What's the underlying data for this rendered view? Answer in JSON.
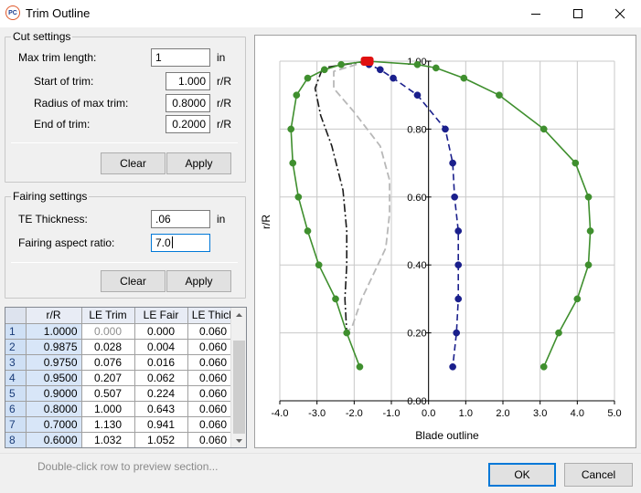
{
  "window": {
    "title": "Trim Outline",
    "app_icon_text": "PC"
  },
  "cut": {
    "legend": "Cut settings",
    "max_trim_label": "Max trim length:",
    "max_trim_value": "1",
    "max_trim_unit": "in",
    "start_label": "Start of trim:",
    "start_value": "1.000",
    "start_unit": "r/R",
    "radius_label": "Radius of max trim:",
    "radius_value": "0.8000",
    "radius_unit": "r/R",
    "end_label": "End of trim:",
    "end_value": "0.2000",
    "end_unit": "r/R",
    "clear_label": "Clear",
    "apply_label": "Apply"
  },
  "fairing": {
    "legend": "Fairing settings",
    "te_label": "TE Thickness:",
    "te_value": ".06",
    "te_unit": "in",
    "aspect_label": "Fairing aspect ratio:",
    "aspect_value": "7.0",
    "clear_label": "Clear",
    "apply_label": "Apply"
  },
  "table": {
    "columns": [
      "r/R",
      "LE Trim",
      "LE Fair",
      "LE Thick"
    ],
    "rows": [
      {
        "n": "1",
        "r": "1.0000",
        "trim": "0.000",
        "fair": "0.000",
        "thick": "0.060"
      },
      {
        "n": "2",
        "r": "0.9875",
        "trim": "0.028",
        "fair": "0.004",
        "thick": "0.060"
      },
      {
        "n": "3",
        "r": "0.9750",
        "trim": "0.076",
        "fair": "0.016",
        "thick": "0.060"
      },
      {
        "n": "4",
        "r": "0.9500",
        "trim": "0.207",
        "fair": "0.062",
        "thick": "0.060"
      },
      {
        "n": "5",
        "r": "0.9000",
        "trim": "0.507",
        "fair": "0.224",
        "thick": "0.060"
      },
      {
        "n": "6",
        "r": "0.8000",
        "trim": "1.000",
        "fair": "0.643",
        "thick": "0.060"
      },
      {
        "n": "7",
        "r": "0.7000",
        "trim": "1.130",
        "fair": "0.941",
        "thick": "0.060"
      },
      {
        "n": "8",
        "r": "0.6000",
        "trim": "1.032",
        "fair": "1.052",
        "thick": "0.060"
      }
    ]
  },
  "status_text": "Double-click row to preview section...",
  "ok_label": "OK",
  "cancel_label": "Cancel",
  "colors": {
    "outline": "#3f8f2e",
    "trim": "#1a1f8c",
    "fair": "#b8b8b8",
    "cut": "#1a1a1a",
    "marker": "#e01010",
    "accent": "#0078d7"
  },
  "chart_data": {
    "type": "line",
    "xlabel": "Blade outline",
    "ylabel": "r/R",
    "xlim": [
      -4.0,
      5.0
    ],
    "ylim": [
      0.0,
      1.0
    ],
    "x_ticks": [
      "-4.0",
      "-3.0",
      "-2.0",
      "-1.0",
      "0.0",
      "1.0",
      "2.0",
      "3.0",
      "4.0",
      "5.0"
    ],
    "y_ticks": [
      "0.00",
      "0.20",
      "0.40",
      "0.60",
      "0.80",
      "1.00"
    ],
    "grid": true,
    "series": [
      {
        "role": "outline",
        "style": "solid-markers",
        "points": [
          [
            -1.85,
            0.1
          ],
          [
            -2.2,
            0.2
          ],
          [
            -2.5,
            0.3
          ],
          [
            -2.95,
            0.4
          ],
          [
            -3.25,
            0.5
          ],
          [
            -3.5,
            0.6
          ],
          [
            -3.65,
            0.7
          ],
          [
            -3.7,
            0.8
          ],
          [
            -3.55,
            0.9
          ],
          [
            -3.25,
            0.95
          ],
          [
            -2.8,
            0.975
          ],
          [
            -2.35,
            0.99
          ],
          [
            -1.65,
            1.0
          ],
          [
            -0.3,
            0.99
          ],
          [
            0.2,
            0.98
          ],
          [
            0.95,
            0.95
          ],
          [
            1.9,
            0.9
          ],
          [
            3.1,
            0.8
          ],
          [
            3.95,
            0.7
          ],
          [
            4.3,
            0.6
          ],
          [
            4.35,
            0.5
          ],
          [
            4.3,
            0.4
          ],
          [
            4.0,
            0.3
          ],
          [
            3.5,
            0.2
          ],
          [
            3.1,
            0.1
          ]
        ]
      },
      {
        "role": "trim",
        "style": "dashed-markers",
        "points": [
          [
            -1.65,
            1.0
          ],
          [
            -1.6,
            0.99
          ],
          [
            -1.3,
            0.975
          ],
          [
            -0.95,
            0.95
          ],
          [
            -0.3,
            0.9
          ],
          [
            0.45,
            0.8
          ],
          [
            0.65,
            0.7
          ],
          [
            0.7,
            0.6
          ],
          [
            0.8,
            0.5
          ],
          [
            0.8,
            0.4
          ],
          [
            0.8,
            0.3
          ],
          [
            0.75,
            0.2
          ],
          [
            0.65,
            0.1
          ]
        ]
      },
      {
        "role": "fair",
        "style": "dashed",
        "points": [
          [
            -1.65,
            1.0
          ],
          [
            -2.55,
            0.97
          ],
          [
            -2.55,
            0.92
          ],
          [
            -2.0,
            0.85
          ],
          [
            -1.3,
            0.75
          ],
          [
            -1.05,
            0.65
          ],
          [
            -1.05,
            0.55
          ],
          [
            -1.15,
            0.45
          ],
          [
            -1.45,
            0.38
          ],
          [
            -1.8,
            0.3
          ],
          [
            -2.05,
            0.22
          ],
          [
            -2.2,
            0.2
          ]
        ]
      },
      {
        "role": "cut",
        "style": "dash-dot",
        "points": [
          [
            -1.65,
            1.0
          ],
          [
            -2.85,
            0.98
          ],
          [
            -3.05,
            0.92
          ],
          [
            -2.9,
            0.84
          ],
          [
            -2.6,
            0.75
          ],
          [
            -2.3,
            0.62
          ],
          [
            -2.2,
            0.5
          ],
          [
            -2.2,
            0.4
          ],
          [
            -2.25,
            0.3
          ],
          [
            -2.2,
            0.2
          ]
        ]
      }
    ],
    "tip_marker": {
      "x": -1.65,
      "y": 1.0
    }
  }
}
